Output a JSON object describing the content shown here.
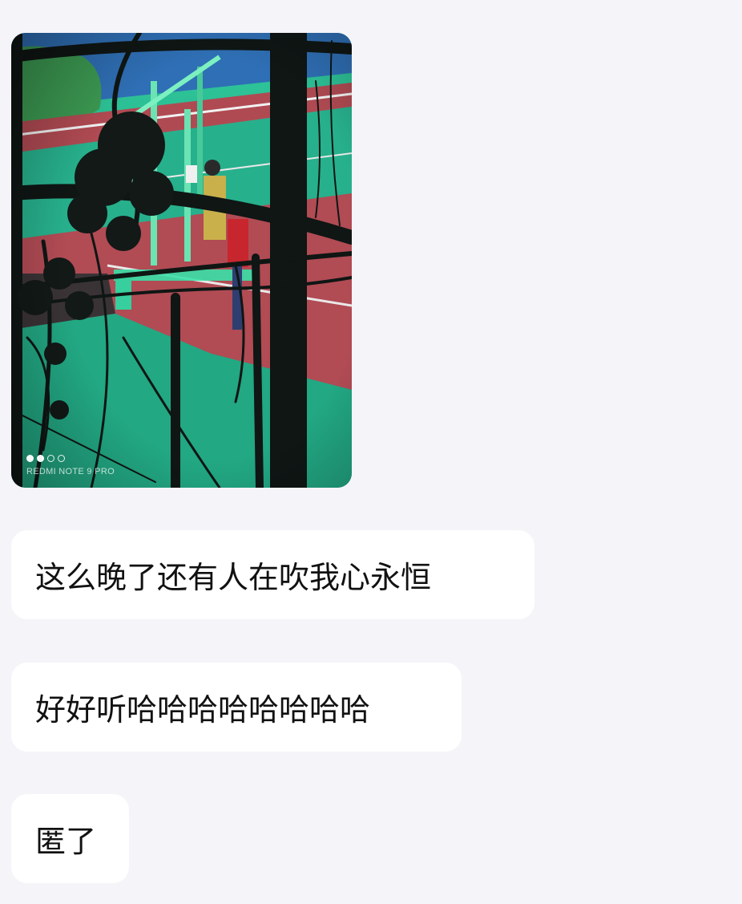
{
  "messages": [
    {
      "type": "image",
      "watermark": "REDMI NOTE 9 PRO",
      "counter_dots": [
        true,
        true,
        false,
        false
      ],
      "colors": {
        "track_green": "#2bb38d",
        "track_red": "#b04a52",
        "sky_blue": "#2f6fb5",
        "shadow": "#0f1614"
      }
    },
    {
      "type": "text",
      "text": "这么晚了还有人在吹我心永恒"
    },
    {
      "type": "text",
      "text": "好好听哈哈哈哈哈哈哈哈"
    },
    {
      "type": "text",
      "text": "匿了"
    }
  ],
  "theme": {
    "background": "#f5f4f8",
    "bubble_bg": "#ffffff",
    "text_color": "#111111"
  }
}
